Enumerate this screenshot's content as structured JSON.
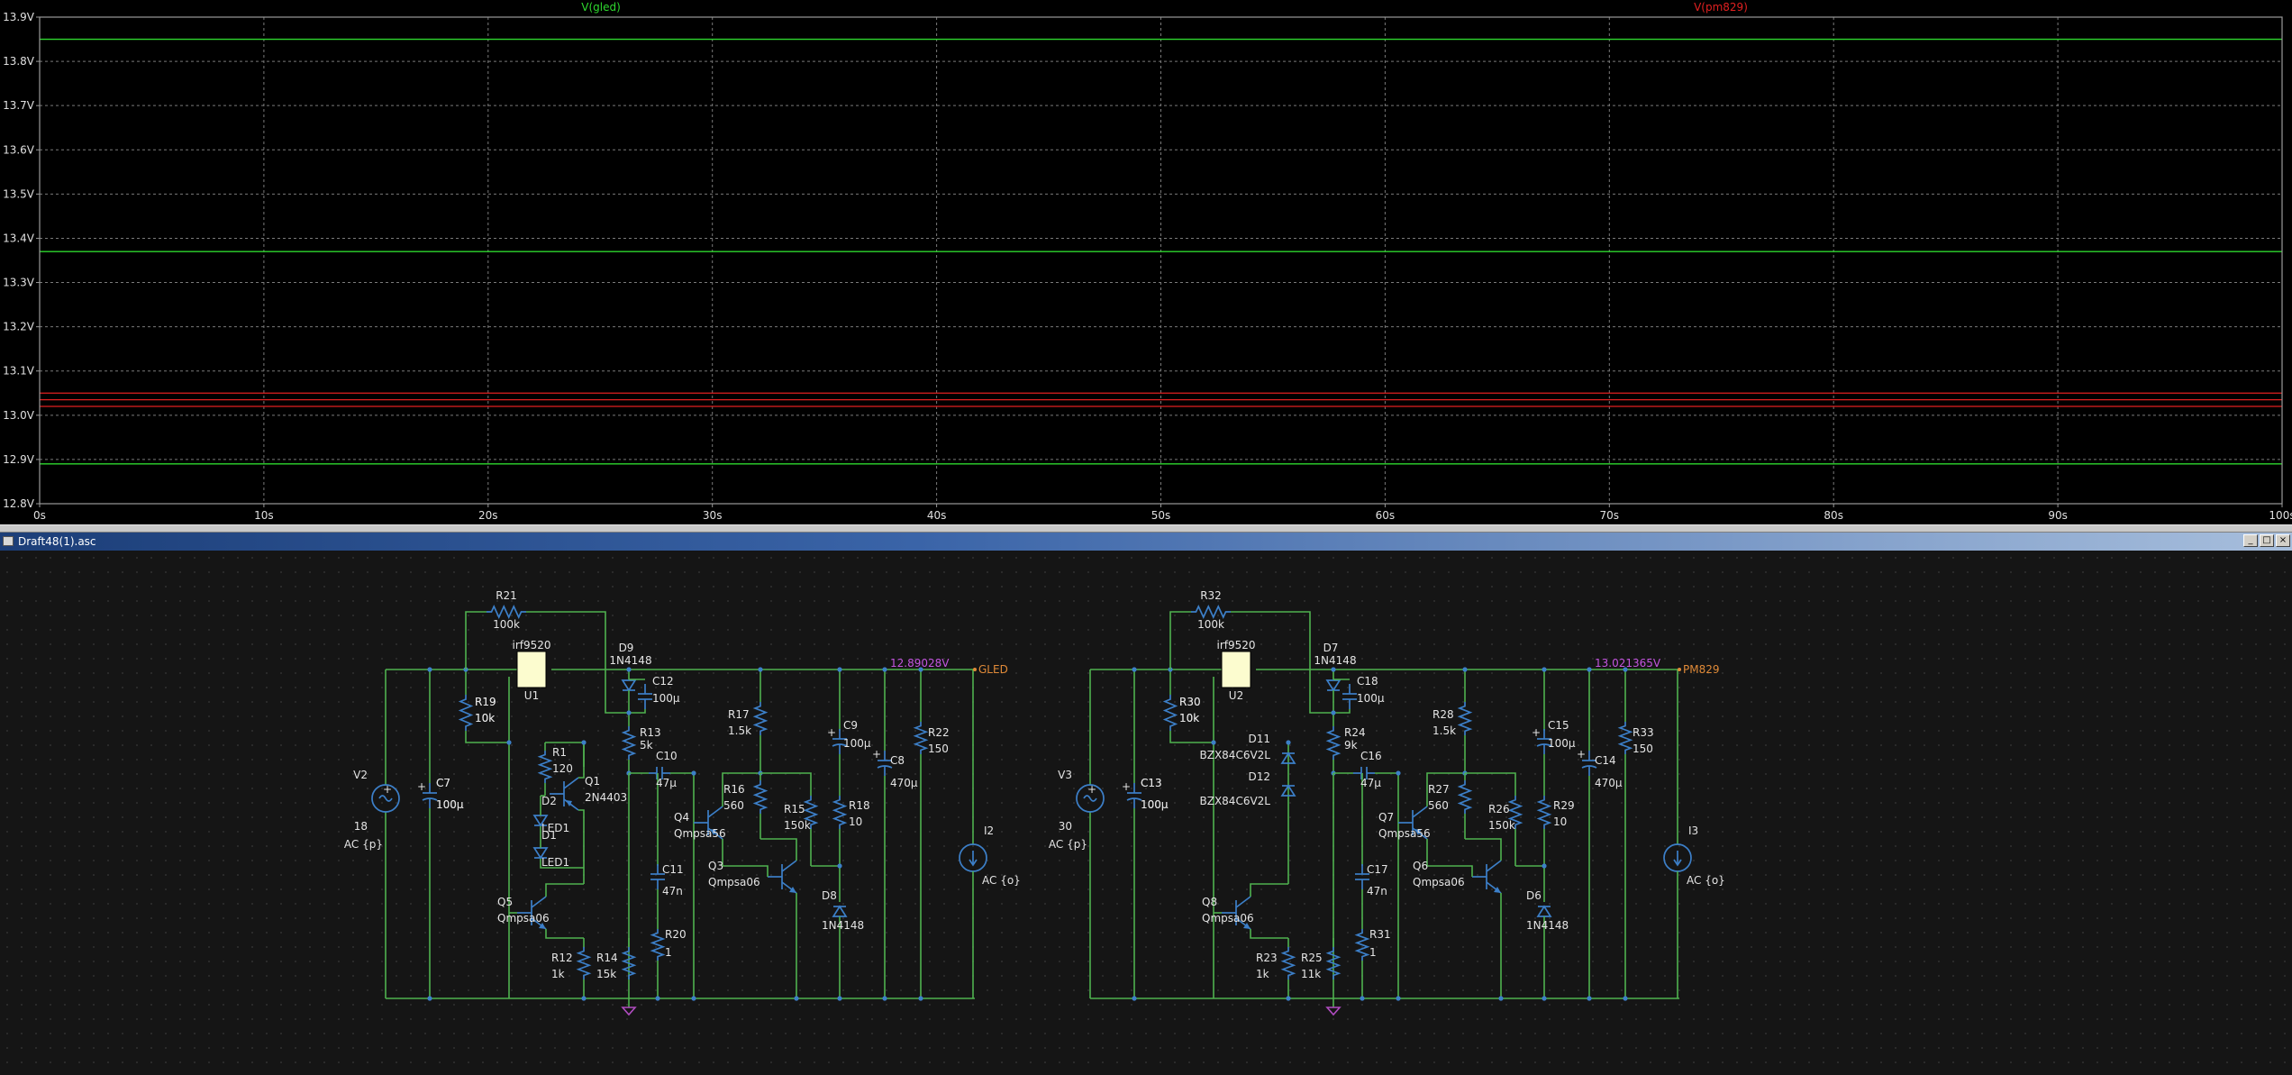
{
  "plot": {
    "trace_labels": [
      {
        "text": "V(gled)",
        "color": "#2ed82e"
      },
      {
        "text": "V(pm829)",
        "color": "#e02020"
      }
    ],
    "y_ticks": [
      "13.9V",
      "13.8V",
      "13.7V",
      "13.6V",
      "13.5V",
      "13.4V",
      "13.3V",
      "13.2V",
      "13.1V",
      "13.0V",
      "12.9V",
      "12.8V"
    ],
    "x_ticks": [
      "0s",
      "10s",
      "20s",
      "30s",
      "40s",
      "50s",
      "60s",
      "70s",
      "80s",
      "90s",
      "100s"
    ],
    "colors": {
      "gled": "#2ed82e",
      "pm829": "#e02020",
      "grid": "#7a7a7a",
      "frame": "#9a9a9a"
    }
  },
  "chart_data": {
    "type": "line",
    "title": "",
    "xlabel": "",
    "ylabel": "",
    "xlim": [
      0,
      100
    ],
    "ylim": [
      12.8,
      13.9
    ],
    "grid": true,
    "series": [
      {
        "name": "V(gled)",
        "color": "#2ed82e",
        "x": [
          0,
          100
        ],
        "y": [
          12.89,
          12.89
        ]
      },
      {
        "name": "V(gled)",
        "color": "#2ed82e",
        "x": [
          0,
          100
        ],
        "y": [
          13.37,
          13.37
        ]
      },
      {
        "name": "V(gled)",
        "color": "#2ed82e",
        "x": [
          0,
          100
        ],
        "y": [
          13.85,
          13.85
        ]
      },
      {
        "name": "V(pm829)",
        "color": "#e02020",
        "x": [
          0,
          100
        ],
        "y": [
          13.02,
          13.02
        ]
      },
      {
        "name": "V(pm829)",
        "color": "#e02020",
        "x": [
          0,
          100
        ],
        "y": [
          13.035,
          13.035
        ]
      },
      {
        "name": "V(pm829)",
        "color": "#e02020",
        "x": [
          0,
          100
        ],
        "y": [
          13.05,
          13.05
        ]
      }
    ]
  },
  "schematic": {
    "window_title": "Draft48(1).asc",
    "window_buttons": [
      "_",
      "□",
      "×"
    ],
    "left": {
      "voltage": "12.89028V",
      "net": "GLED",
      "v_source": {
        "ref": "V2",
        "value": "18",
        "model": "AC {p}"
      },
      "i_source": {
        "ref": "I2",
        "model": "AC {o}"
      },
      "mosfet": {
        "model": "irf9520",
        "ref": "U1"
      },
      "d_top": {
        "ref": "D9",
        "model": "1N4148"
      },
      "r_top": {
        "ref": "R21",
        "value": "100k"
      },
      "components": [
        {
          "ref": "R19",
          "value": "10k"
        },
        {
          "ref": "C7",
          "value": "100µ"
        },
        {
          "ref": "R1",
          "value": "120"
        },
        {
          "ref": "Q1",
          "value": "2N4403"
        },
        {
          "ref": "D2",
          "value": "LED1"
        },
        {
          "ref": "D1",
          "value": "LED1"
        },
        {
          "ref": "Q5",
          "value": "Qmpsa06"
        },
        {
          "ref": "R12",
          "value": "1k"
        },
        {
          "ref": "R14",
          "value": "15k"
        },
        {
          "ref": "C12",
          "value": "100µ"
        },
        {
          "ref": "R13",
          "value": "5k"
        },
        {
          "ref": "C10",
          "value": "47µ"
        },
        {
          "ref": "Q4",
          "value": "Qmpsa56"
        },
        {
          "ref": "C11",
          "value": "47n"
        },
        {
          "ref": "R20",
          "value": "1"
        },
        {
          "ref": "R17",
          "value": "1.5k"
        },
        {
          "ref": "R16",
          "value": "560"
        },
        {
          "ref": "R15",
          "value": "150k"
        },
        {
          "ref": "Q3",
          "value": "Qmpsa06"
        },
        {
          "ref": "C9",
          "value": "100µ"
        },
        {
          "ref": "R18",
          "value": "10"
        },
        {
          "ref": "D8",
          "value": "1N4148"
        },
        {
          "ref": "C8",
          "value": "470µ"
        },
        {
          "ref": "R22",
          "value": "150"
        }
      ]
    },
    "right": {
      "voltage": "13.021365V",
      "net": "PM829",
      "v_source": {
        "ref": "V3",
        "value": "30",
        "model": "AC {p}"
      },
      "i_source": {
        "ref": "I3",
        "model": "AC {o}"
      },
      "mosfet": {
        "model": "irf9520",
        "ref": "U2"
      },
      "d_top": {
        "ref": "D7",
        "model": "1N4148"
      },
      "r_top": {
        "ref": "R32",
        "value": "100k"
      },
      "components": [
        {
          "ref": "R30",
          "value": "10k"
        },
        {
          "ref": "C13",
          "value": "100µ"
        },
        {
          "ref": "D11",
          "value": "BZX84C6V2L"
        },
        {
          "ref": "D12",
          "value": "BZX84C6V2L"
        },
        {
          "ref": "Q8",
          "value": "Qmpsa06"
        },
        {
          "ref": "R23",
          "value": "1k"
        },
        {
          "ref": "R25",
          "value": "11k"
        },
        {
          "ref": "C18",
          "value": "100µ"
        },
        {
          "ref": "R24",
          "value": "9k"
        },
        {
          "ref": "C16",
          "value": "47µ"
        },
        {
          "ref": "Q7",
          "value": "Qmpsa56"
        },
        {
          "ref": "C17",
          "value": "47n"
        },
        {
          "ref": "R31",
          "value": "1"
        },
        {
          "ref": "R28",
          "value": "1.5k"
        },
        {
          "ref": "R27",
          "value": "560"
        },
        {
          "ref": "R26",
          "value": "150k"
        },
        {
          "ref": "Q6",
          "value": "Qmpsa06"
        },
        {
          "ref": "C15",
          "value": "100µ"
        },
        {
          "ref": "R29",
          "value": "10"
        },
        {
          "ref": "D6",
          "value": "1N4148"
        },
        {
          "ref": "C14",
          "value": "470µ"
        },
        {
          "ref": "R33",
          "value": "150"
        }
      ]
    }
  }
}
